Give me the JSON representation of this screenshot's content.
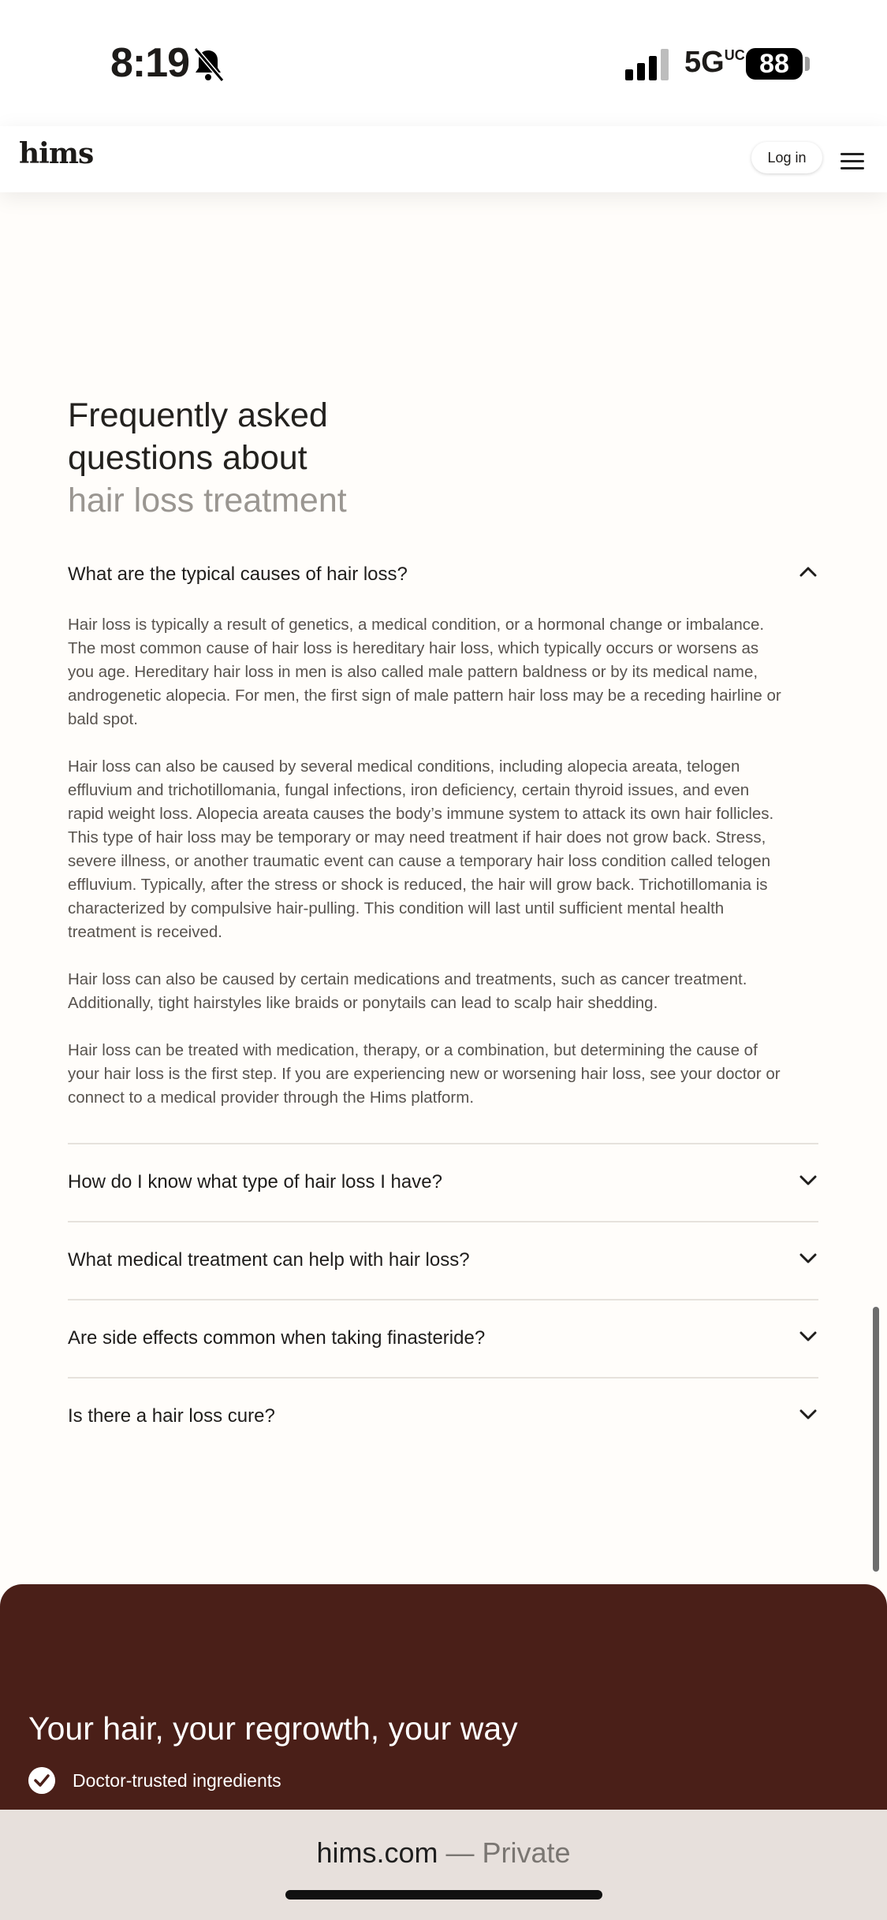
{
  "status_bar": {
    "time": "8:19",
    "network": "5G",
    "network_suffix": "UC",
    "battery": "88"
  },
  "header": {
    "logo": "hims",
    "login_label": "Log in"
  },
  "faq": {
    "title_line1": "Frequently asked",
    "title_line2": "questions about",
    "title_line3": "hair loss treatment",
    "items": [
      {
        "question": "What are the typical causes of hair loss?",
        "expanded": true,
        "paragraphs": [
          "Hair loss is typically a result of genetics, a medical condition, or a hormonal change or imbalance. The most common cause of hair loss is hereditary hair loss, which typically occurs or worsens as you age. Hereditary hair loss in men is also called male pattern baldness or by its medical name, androgenetic alopecia. For men, the first sign of male pattern hair loss may be a receding hairline or bald spot.",
          "Hair loss can also be caused by several medical conditions, including alopecia areata, telogen effluvium and trichotillomania, fungal infections, iron deficiency, certain thyroid issues, and even rapid weight loss. Alopecia areata causes the body’s immune system to attack its own hair follicles. This type of hair loss may be temporary or may need treatment if hair does not grow back. Stress, severe illness, or another traumatic event can cause a temporary hair loss condition called telogen effluvium. Typically, after the stress or shock is reduced, the hair will grow back. Trichotillomania is characterized by compulsive hair-pulling. This condition will last until sufficient mental health treatment is received.",
          "Hair loss can also be caused by certain medications and treatments, such as cancer treatment. Additionally, tight hairstyles like braids or ponytails can lead to scalp hair shedding.",
          "Hair loss can be treated with medication, therapy, or a combination, but determining the cause of your hair loss is the first step. If you are experiencing new or worsening hair loss, see your doctor or connect to a medical provider through the Hims platform."
        ]
      },
      {
        "question": "How do I know what type of hair loss I have?",
        "expanded": false
      },
      {
        "question": "What medical treatment can help with hair loss?",
        "expanded": false
      },
      {
        "question": "Are side effects common when taking finasteride?",
        "expanded": false
      },
      {
        "question": "Is there a hair loss cure?",
        "expanded": false
      }
    ]
  },
  "promo": {
    "title": "Your hair, your regrowth, your way",
    "benefits": [
      "Doctor-trusted ingredients"
    ]
  },
  "browser": {
    "domain": "hims.com",
    "mode": "— Private"
  },
  "colors": {
    "promo_bg": "#4a1f18",
    "page_bg": "#fffdfa",
    "browser_bar": "#e7e0dc"
  }
}
